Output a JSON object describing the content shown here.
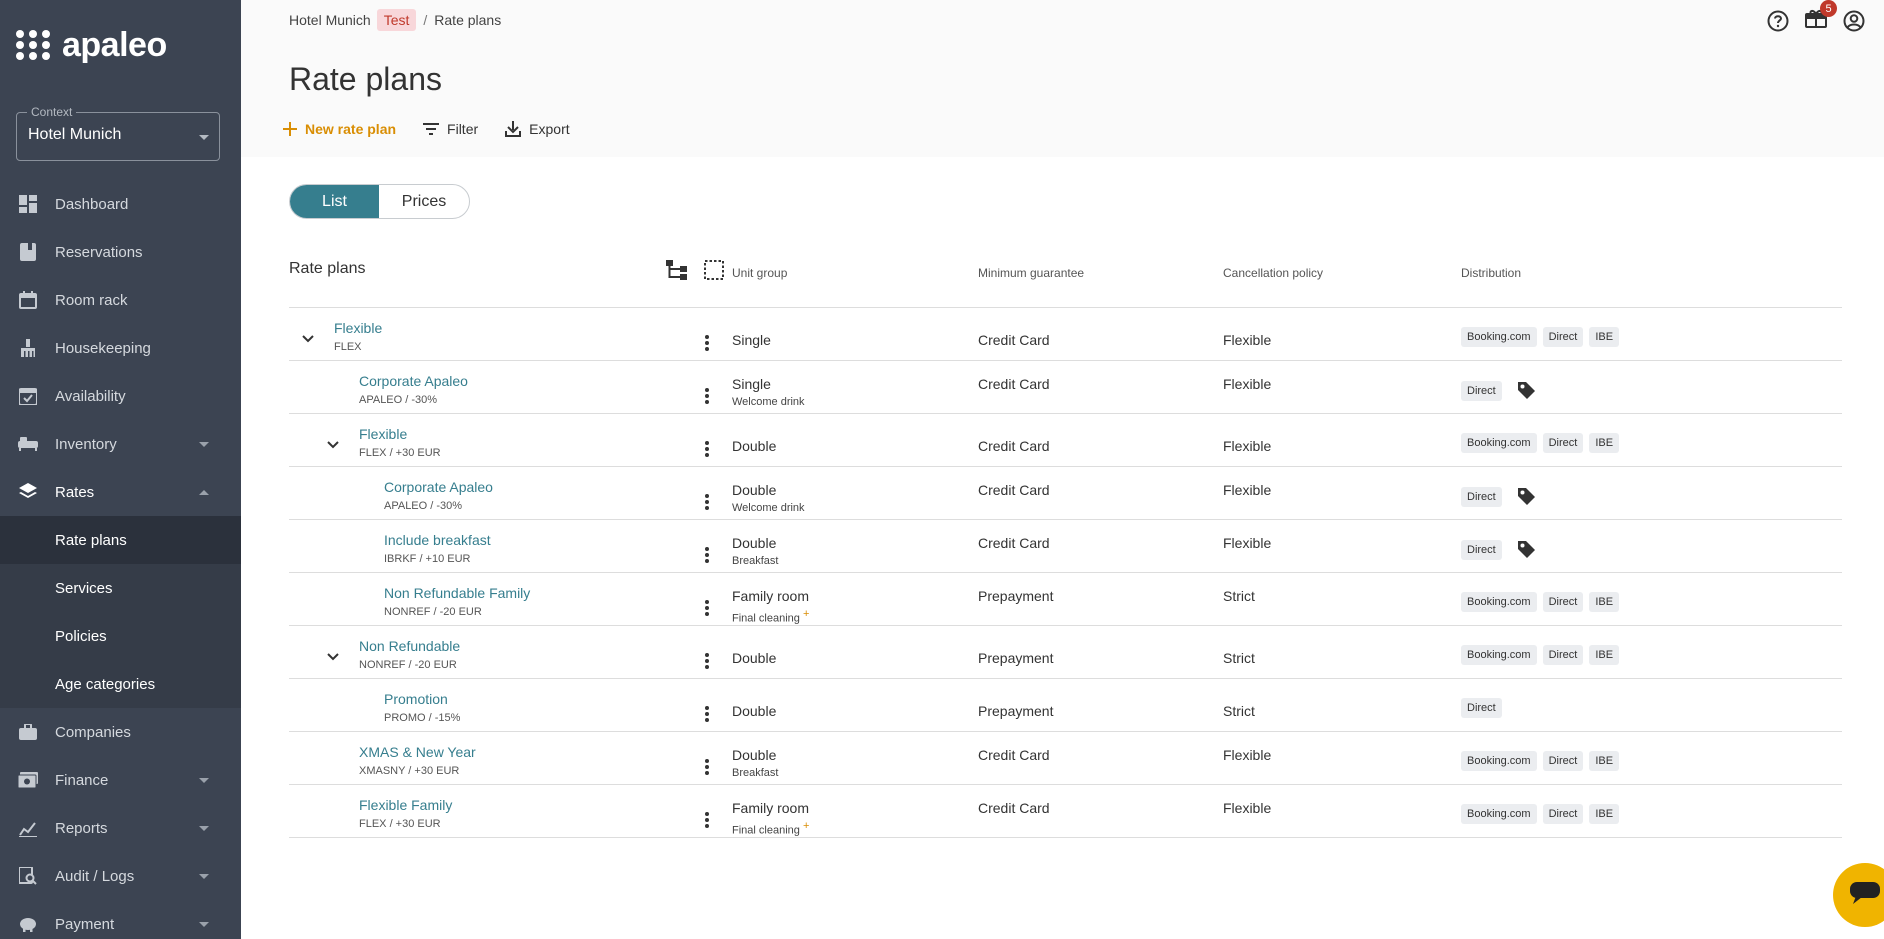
{
  "brand": {
    "name": "apaleo"
  },
  "context": {
    "label": "Context",
    "value": "Hotel Munich"
  },
  "nav": {
    "dashboard": "Dashboard",
    "reservations": "Reservations",
    "room_rack": "Room rack",
    "housekeeping": "Housekeeping",
    "availability": "Availability",
    "inventory": "Inventory",
    "rates": "Rates",
    "rate_plans": "Rate plans",
    "services": "Services",
    "policies": "Policies",
    "age_categories": "Age categories",
    "companies": "Companies",
    "finance": "Finance",
    "reports": "Reports",
    "audit_logs": "Audit / Logs",
    "payment": "Payment"
  },
  "breadcrumb": {
    "hotel": "Hotel Munich",
    "badge": "Test",
    "separator": "/",
    "current": "Rate plans"
  },
  "notifications": {
    "count": "5"
  },
  "page": {
    "title": "Rate plans"
  },
  "actions": {
    "new": "New rate plan",
    "filter": "Filter",
    "export": "Export"
  },
  "view_toggle": {
    "list": "List",
    "prices": "Prices"
  },
  "table": {
    "headers": {
      "rate_plans": "Rate plans",
      "unit_group": "Unit group",
      "minimum_guarantee": "Minimum guarantee",
      "cancellation_policy": "Cancellation policy",
      "distribution": "Distribution"
    },
    "rows": [
      {
        "name": "Flexible",
        "code": "FLEX",
        "unit": "Single",
        "unit_sub": "",
        "guarantee": "Credit Card",
        "policy": "Flexible"
      },
      {
        "name": "Corporate Apaleo",
        "code": "APALEO  /  -30%",
        "unit": "Single",
        "unit_sub": "Welcome drink",
        "guarantee": "Credit Card",
        "policy": "Flexible"
      },
      {
        "name": "Flexible",
        "code": "FLEX  /  +30 EUR",
        "unit": "Double",
        "unit_sub": "",
        "guarantee": "Credit Card",
        "policy": "Flexible"
      },
      {
        "name": "Corporate Apaleo",
        "code": "APALEO  /  -30%",
        "unit": "Double",
        "unit_sub": "Welcome drink",
        "guarantee": "Credit Card",
        "policy": "Flexible"
      },
      {
        "name": "Include breakfast",
        "code": "IBRKF  /  +10 EUR",
        "unit": "Double",
        "unit_sub": "Breakfast",
        "guarantee": "Credit Card",
        "policy": "Flexible"
      },
      {
        "name": "Non Refundable Family",
        "code": "NONREF  /  -20 EUR",
        "unit": "Family room",
        "unit_sub": "Final cleaning",
        "guarantee": "Prepayment",
        "policy": "Strict"
      },
      {
        "name": "Non Refundable",
        "code": "NONREF  /  -20 EUR",
        "unit": "Double",
        "unit_sub": "",
        "guarantee": "Prepayment",
        "policy": "Strict"
      },
      {
        "name": "Promotion",
        "code": "PROMO  /  -15%",
        "unit": "Double",
        "unit_sub": "",
        "guarantee": "Prepayment",
        "policy": "Strict"
      },
      {
        "name": "XMAS & New Year",
        "code": "XMASNY  /  +30 EUR",
        "unit": "Double",
        "unit_sub": "Breakfast",
        "guarantee": "Credit Card",
        "policy": "Flexible"
      },
      {
        "name": "Flexible Family",
        "code": "FLEX  /  +30 EUR",
        "unit": "Family room",
        "unit_sub": "Final cleaning",
        "guarantee": "Credit Card",
        "policy": "Flexible"
      }
    ],
    "plus_mark": "+",
    "channels": {
      "booking": "Booking.com",
      "direct": "Direct",
      "ibe": "IBE"
    }
  },
  "colors": {
    "sidebar": "#3c4452",
    "accent": "#367e8e",
    "primary_action": "#d98e04",
    "chat": "#f0b400"
  }
}
